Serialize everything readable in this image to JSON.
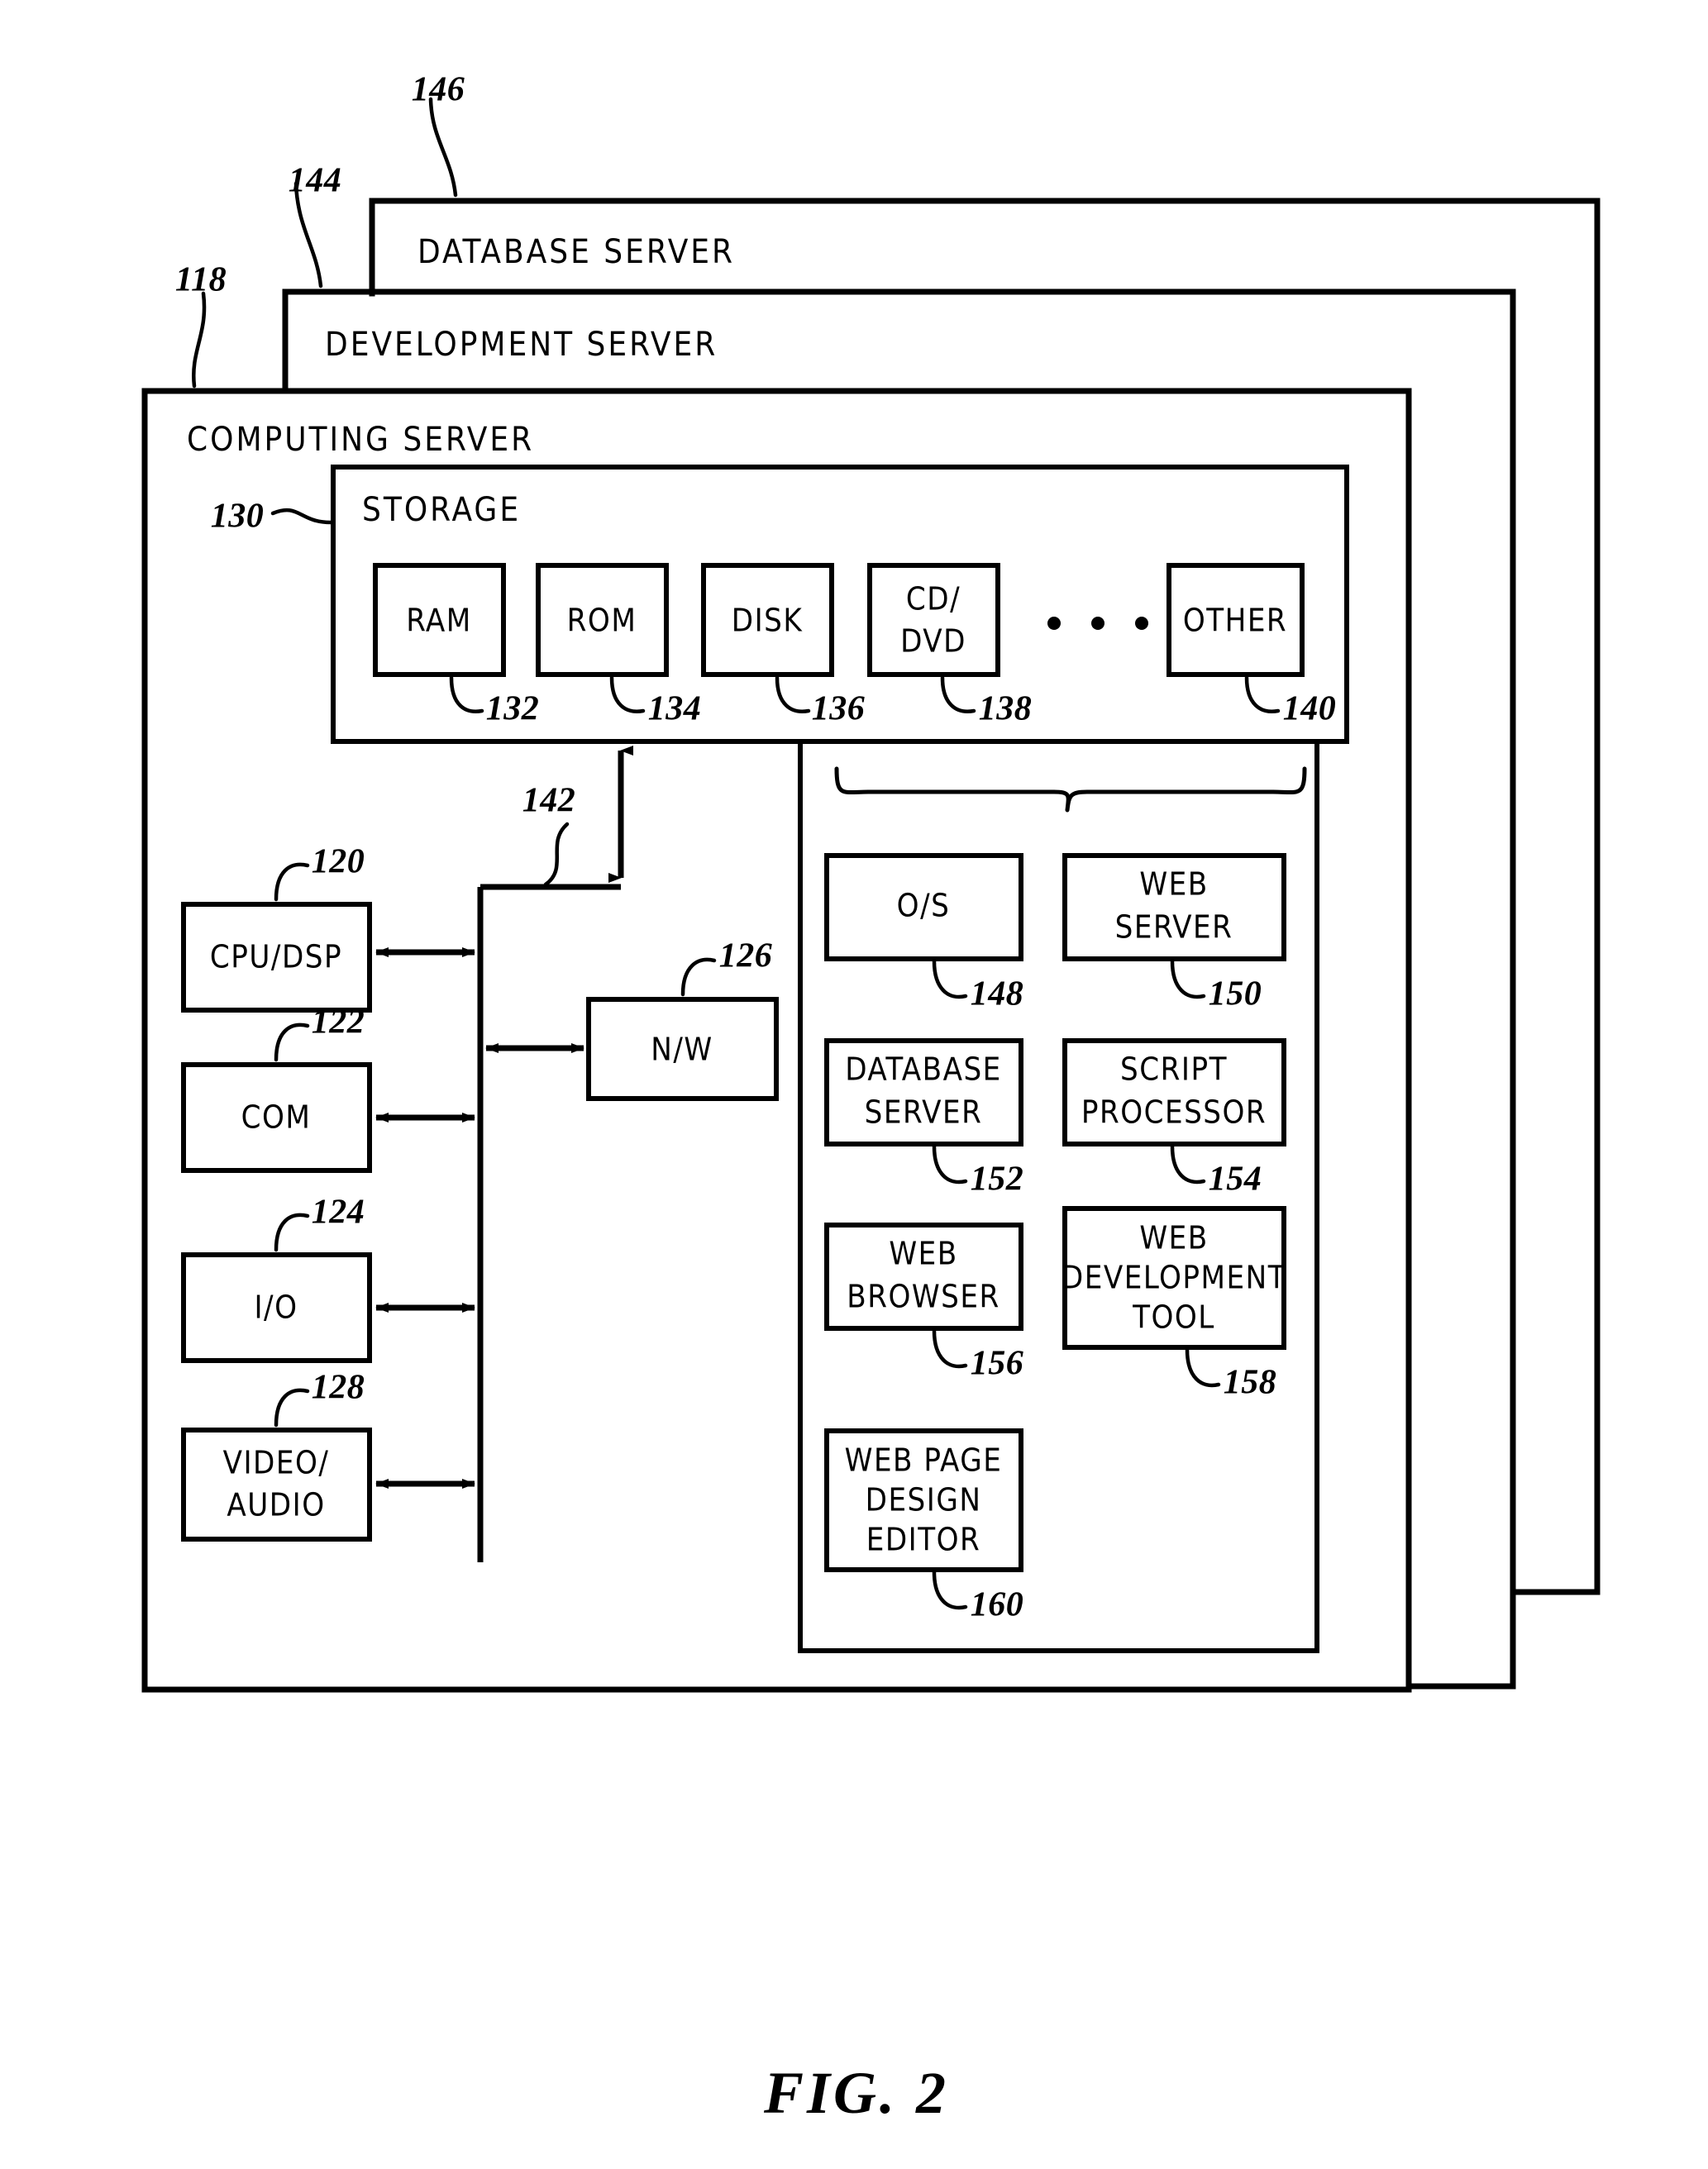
{
  "figure": {
    "caption": "FIG. 2"
  },
  "frames": [
    {
      "id": "database-server",
      "title": "DATABASE SERVER",
      "ref": "146"
    },
    {
      "id": "development-server",
      "title": "DEVELOPMENT SERVER",
      "ref": "144"
    },
    {
      "id": "computing-server",
      "title": "COMPUTING SERVER",
      "ref": "118"
    }
  ],
  "storage": {
    "title": "STORAGE",
    "ref": "130",
    "ellipsis": "• • •",
    "items": [
      {
        "label": "RAM",
        "ref": "132"
      },
      {
        "label": "ROM",
        "ref": "134"
      },
      {
        "label": "DISK",
        "ref": "136"
      },
      {
        "label_line1": "CD/",
        "label_line2": "DVD",
        "ref": "138"
      },
      {
        "label": "OTHER",
        "ref": "140"
      }
    ]
  },
  "bus": {
    "ref": "142"
  },
  "hardware": [
    {
      "label": "CPU/DSP",
      "ref": "120"
    },
    {
      "label": "COM",
      "ref": "122"
    },
    {
      "label": "I/O",
      "ref": "124"
    },
    {
      "label_line1": "VIDEO/",
      "label_line2": "AUDIO",
      "ref": "128"
    }
  ],
  "network": {
    "label": "N/W",
    "ref": "126"
  },
  "software": [
    {
      "label_line1": "O/S",
      "ref": "148"
    },
    {
      "label_line1": "WEB",
      "label_line2": "SERVER",
      "ref": "150"
    },
    {
      "label_line1": "DATABASE",
      "label_line2": "SERVER",
      "ref": "152"
    },
    {
      "label_line1": "SCRIPT",
      "label_line2": "PROCESSOR",
      "ref": "154"
    },
    {
      "label_line1": "WEB",
      "label_line2": "BROWSER",
      "ref": "156"
    },
    {
      "label_line1": "WEB",
      "label_line2": "DEVELOPMENT",
      "label_line3": "TOOL",
      "ref": "158"
    },
    {
      "label_line1": "WEB PAGE",
      "label_line2": "DESIGN",
      "label_line3": "EDITOR",
      "ref": "160"
    }
  ],
  "colors": {
    "stroke": "#000000",
    "background": "#ffffff"
  }
}
